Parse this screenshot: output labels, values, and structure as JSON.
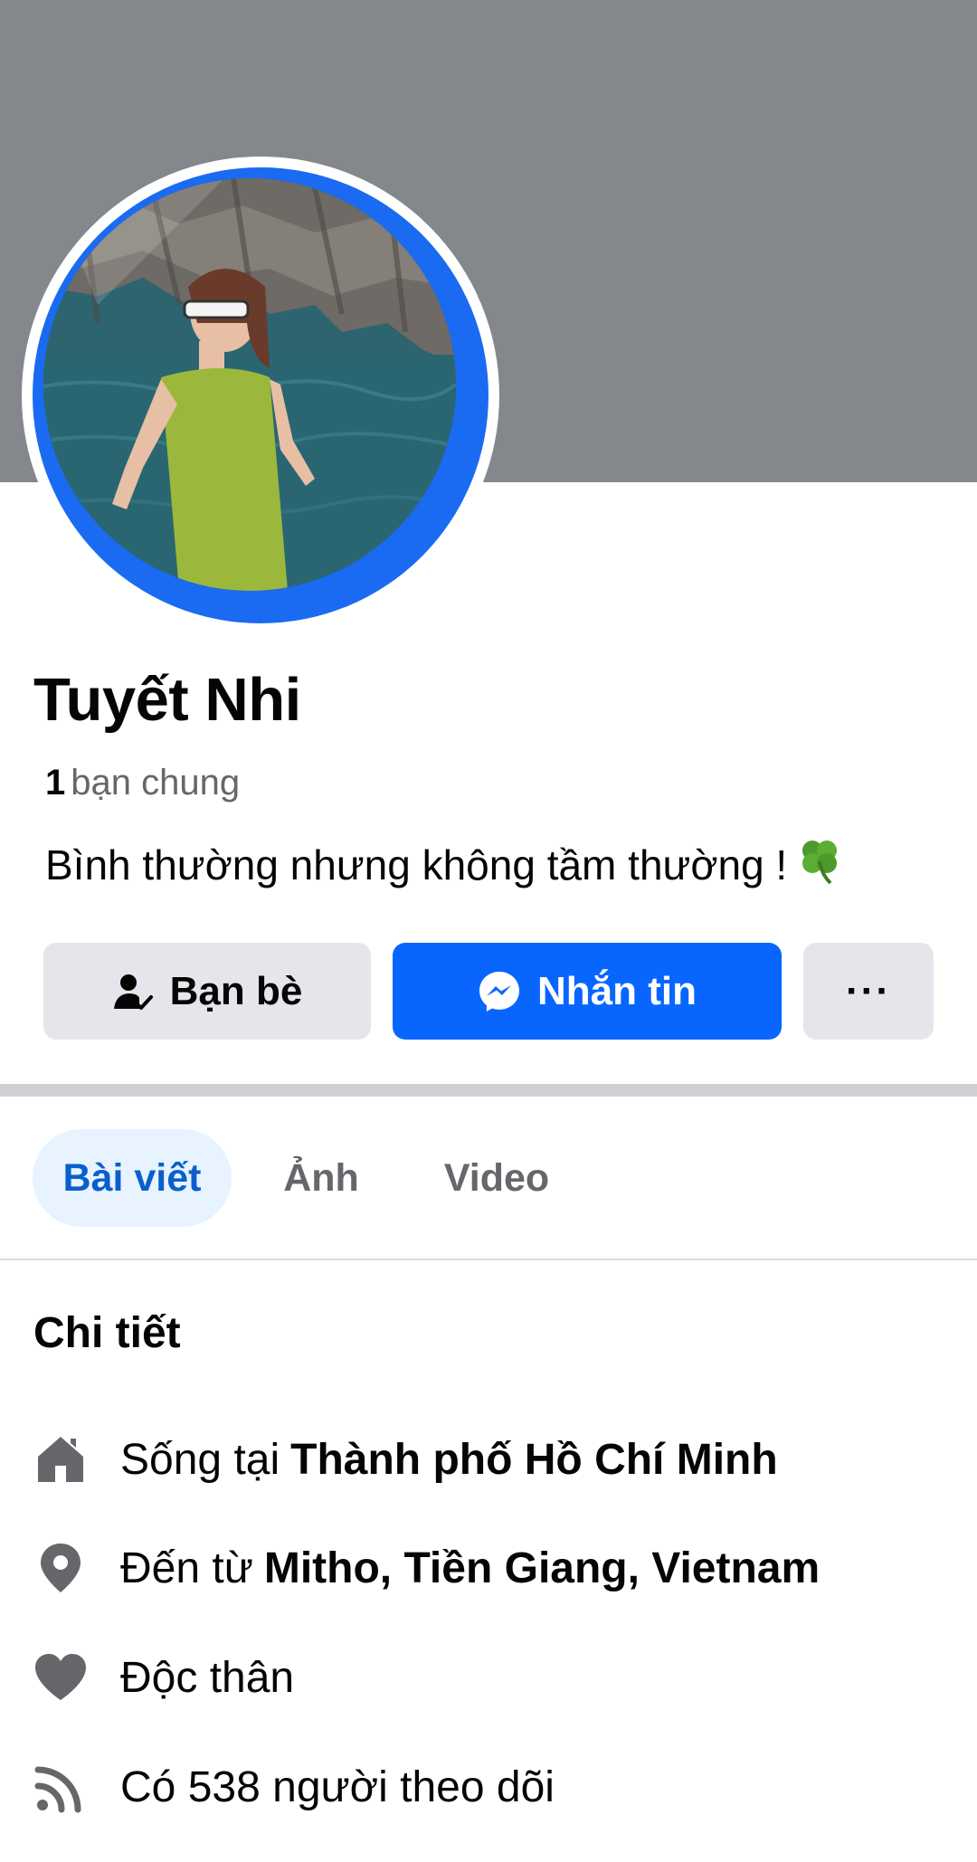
{
  "profile": {
    "name": "Tuyết Nhi",
    "mutual_count": "1",
    "mutual_label": "bạn chung",
    "bio": "Bình thường nhưng không tầm thường !",
    "bio_emoji": "four-leaf-clover-icon"
  },
  "actions": {
    "friends_label": "Bạn bè",
    "message_label": "Nhắn tin",
    "more_label": "···"
  },
  "tabs": [
    {
      "label": "Bài viết",
      "active": true
    },
    {
      "label": "Ảnh",
      "active": false
    },
    {
      "label": "Video",
      "active": false
    }
  ],
  "details": {
    "title": "Chi tiết",
    "items": [
      {
        "icon": "home-icon",
        "prefix": "Sống tại",
        "value": "Thành phố Hồ Chí Minh"
      },
      {
        "icon": "location-pin-icon",
        "prefix": "Đến từ",
        "value": "Mitho, Tiền Giang, Vietnam"
      },
      {
        "icon": "heart-icon",
        "prefix": "Độc thân",
        "value": ""
      },
      {
        "icon": "rss-icon",
        "prefix": "Có 538 người theo dõi",
        "value": ""
      }
    ]
  },
  "colors": {
    "accent": "#0866ff",
    "cover": "#84878b",
    "story_ring": "#1a6bf2",
    "button_gray": "#e4e6eb",
    "active_tab_bg": "#e7f3ff",
    "active_tab_text": "#0b5fcc",
    "secondary_text": "#65676b"
  }
}
